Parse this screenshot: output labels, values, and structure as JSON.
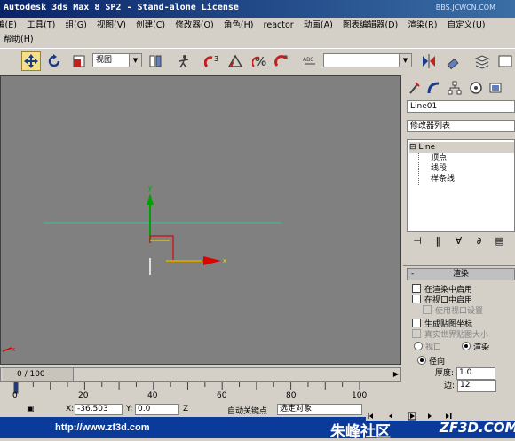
{
  "window": {
    "title": "Autodesk 3ds Max 8 SP2  - Stand-alone License",
    "watermark": "BBS.JCWCN.COM"
  },
  "menu": {
    "row1": [
      "编(E)",
      "工具(T)",
      "组(G)",
      "视图(V)",
      "创建(C)",
      "修改器(O)",
      "角色(H)",
      "reactor",
      "动画(A)",
      "图表编辑器(D)",
      "渲染(R)",
      "自定义(U)"
    ],
    "row2": [
      "帮助(H)"
    ]
  },
  "toolbar": {
    "viewport_select": "视图",
    "named_selection": "",
    "icons": [
      "select-move-icon",
      "select-rotate-icon",
      "select-scale-icon",
      "mirror-icon",
      "snap-3d-icon",
      "angle-snap-icon",
      "percent-snap-icon",
      "spinner-snap-icon",
      "named-selection-icon",
      "align-icon",
      "layer-icon"
    ]
  },
  "viewport": {
    "axis_x": "x",
    "axis_y": "y"
  },
  "command_panel": {
    "object_name": "Line01",
    "modifier_list": "修改器列表",
    "stack": {
      "root": "⊟ Line",
      "items": [
        "顶点",
        "线段",
        "样条线"
      ]
    },
    "rollout": {
      "title": "渲染",
      "checkboxes": [
        {
          "label": "在渲染中启用",
          "enabled": true
        },
        {
          "label": "在视口中启用",
          "enabled": true
        },
        {
          "label": "使用视口设置",
          "enabled": false
        },
        {
          "label": "生成贴图坐标",
          "enabled": true
        },
        {
          "label": "真实世界贴图大小",
          "enabled": false
        }
      ],
      "radio_viewport": "视口",
      "radio_render": "渲染",
      "radio_radial": "径向",
      "thickness_label": "厚度:",
      "thickness_value": "1.0",
      "sides_label": "边:",
      "sides_value": "12"
    }
  },
  "timeline": {
    "frame_display": "0 / 100",
    "ticks": [
      "0",
      "20",
      "40",
      "60",
      "80",
      "100"
    ],
    "current_frame_fraction": 0
  },
  "status": {
    "x_label": "X:",
    "x_value": "-36.503",
    "y_label": "Y:",
    "y_value": "0.0",
    "z_label": "Z",
    "autokey": "自动关键点",
    "selection": "选定对象"
  },
  "footer": {
    "url": "http://www.zf3d.com",
    "brand": "朱峰社区",
    "domain": "ZF3D.COM"
  },
  "colors": {
    "viewport_bg": "#808080",
    "axis_x": "#e00000",
    "axis_y": "#00a000",
    "active_tool": "#f2e08a",
    "footer_bg": "#0a3a9a"
  }
}
